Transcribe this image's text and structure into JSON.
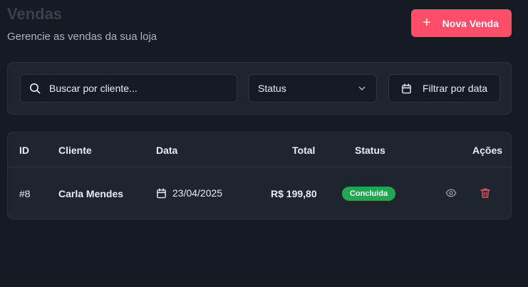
{
  "header": {
    "title": "Vendas",
    "subtitle": "Gerencie as vendas da sua loja",
    "new_sale_label": "Nova Venda",
    "new_sale_icon": "+"
  },
  "filters": {
    "search_placeholder": "Buscar por cliente...",
    "status_label": "Status",
    "date_filter_label": "Filtrar por data"
  },
  "table": {
    "columns": {
      "id": "ID",
      "client": "Cliente",
      "date": "Data",
      "total": "Total",
      "status": "Status",
      "actions": "Ações"
    },
    "rows": [
      {
        "id": "#8",
        "client": "Carla Mendes",
        "date": "23/04/2025",
        "total": "R$ 199,80",
        "status": "Concluída"
      }
    ]
  },
  "colors": {
    "accent": "#ff4d6a",
    "status_completed": "#1fa84f",
    "delete_icon": "#ff4d6a",
    "background": "#161b22",
    "panel": "#1f252d"
  },
  "icons": {
    "search": "search-icon",
    "select": "chevron-down-icon",
    "date": "calendar-icon",
    "view": "eye-icon",
    "delete": "trash-icon"
  }
}
